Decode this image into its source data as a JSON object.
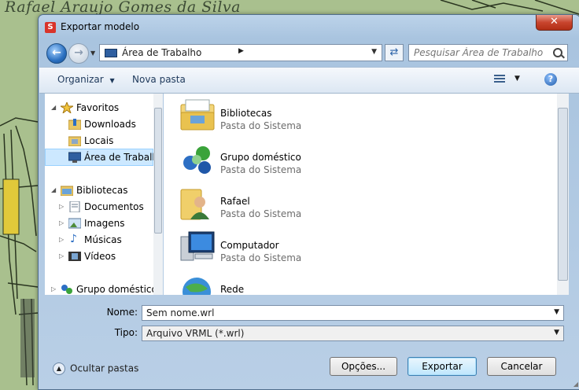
{
  "background": {
    "title": "Rafael Araujo Gomes da Silva"
  },
  "window": {
    "title": "Exportar modelo",
    "close_glyph": "✕"
  },
  "address": {
    "location": "Área de Trabalho",
    "search_placeholder": "Pesquisar Área de Trabalho"
  },
  "toolbar": {
    "organize": "Organizar",
    "organize_arrow": "▼",
    "new_folder": "Nova pasta",
    "help": "?"
  },
  "nav_pane": {
    "items": [
      {
        "label": "Favoritos",
        "icon": "star-icon"
      },
      {
        "label": "Downloads",
        "icon": "downloads-folder-icon"
      },
      {
        "label": "Locais",
        "icon": "recent-places-icon"
      },
      {
        "label": "Área de Trabalh",
        "icon": "desktop-icon"
      },
      {
        "label": "Bibliotecas",
        "icon": "libraries-icon"
      },
      {
        "label": "Documentos",
        "icon": "documents-icon"
      },
      {
        "label": "Imagens",
        "icon": "pictures-icon"
      },
      {
        "label": "Músicas",
        "icon": "music-icon"
      },
      {
        "label": "Vídeos",
        "icon": "videos-icon"
      },
      {
        "label": "Grupo doméstico",
        "icon": "homegroup-icon"
      }
    ]
  },
  "files": [
    {
      "name": "Bibliotecas",
      "type": "Pasta do Sistema",
      "icon": "libraries-icon"
    },
    {
      "name": "Grupo doméstico",
      "type": "Pasta do Sistema",
      "icon": "homegroup-icon"
    },
    {
      "name": "Rafael",
      "type": "Pasta do Sistema",
      "icon": "user-folder-icon"
    },
    {
      "name": "Computador",
      "type": "Pasta do Sistema",
      "icon": "computer-icon"
    },
    {
      "name": "Rede",
      "type": "",
      "icon": "network-icon"
    }
  ],
  "save": {
    "name_label": "Nome:",
    "name_value": "Sem nome.wrl",
    "type_label": "Tipo:",
    "type_value": "Arquivo VRML (*.wrl)"
  },
  "footer": {
    "hide_folders": "Ocultar pastas",
    "options_button": "Opções...",
    "export_button": "Exportar",
    "cancel_button": "Cancelar"
  }
}
